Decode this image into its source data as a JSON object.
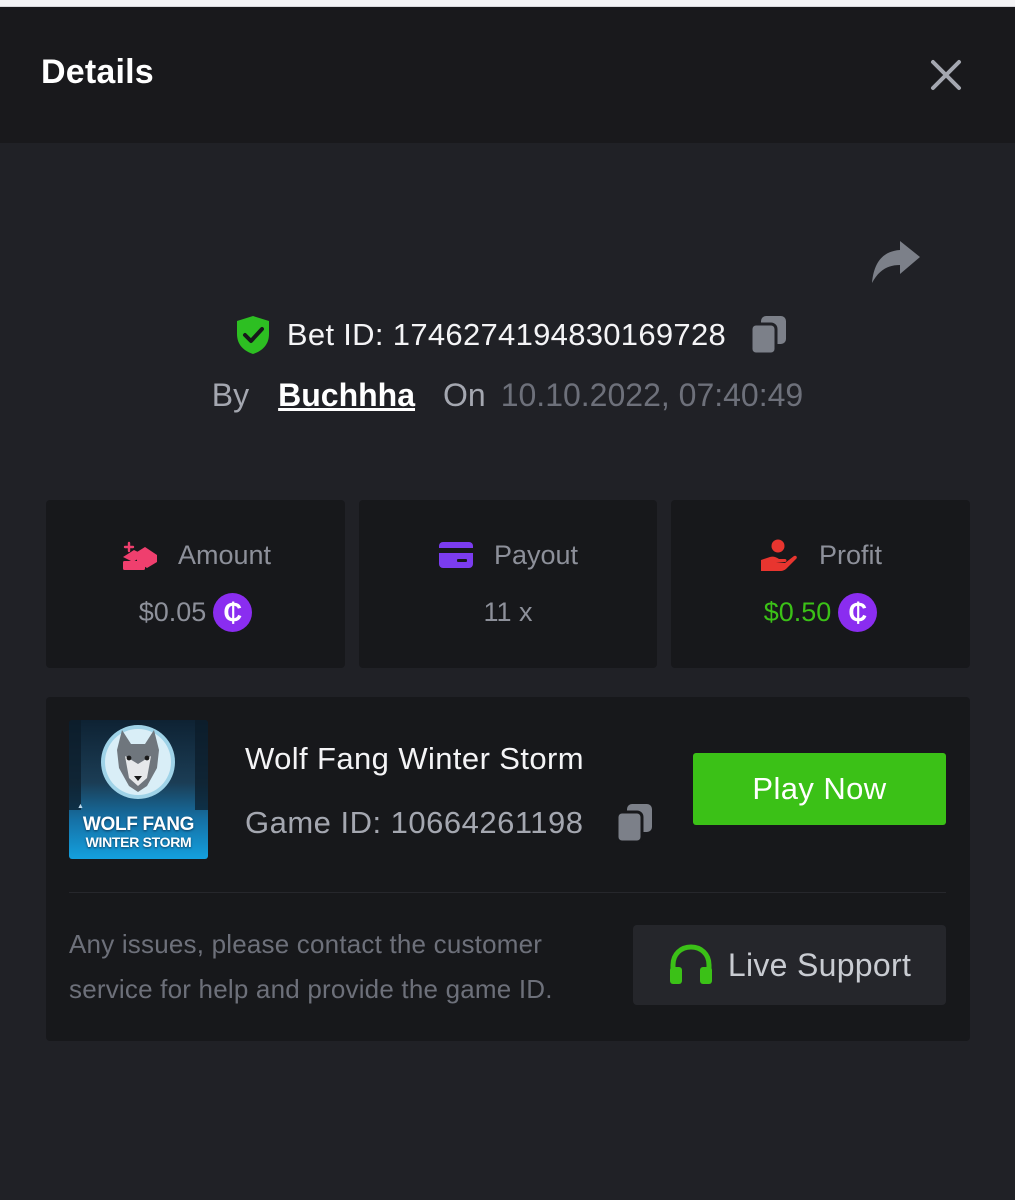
{
  "header": {
    "title": "Details"
  },
  "bet": {
    "id_label": "Bet ID:",
    "id": "1746274194830169728",
    "by_label": "By",
    "username": "Buchhha",
    "on_label": "On",
    "datetime": "10.10.2022, 07:40:49"
  },
  "stats": {
    "amount": {
      "label": "Amount",
      "value": "$0.05",
      "coin": "₵",
      "icon": "amount-icon"
    },
    "payout": {
      "label": "Payout",
      "value": "11 x",
      "icon": "card-icon"
    },
    "profit": {
      "label": "Profit",
      "value": "$0.50",
      "coin": "₵",
      "icon": "hand-coin-icon"
    }
  },
  "game": {
    "name": "Wolf Fang Winter Storm",
    "id_label": "Game ID:",
    "id": "10664261198",
    "play_label": "Play Now",
    "thumbnail": {
      "line1": "WOLF FANG",
      "line2": "WINTER STORM"
    }
  },
  "support": {
    "help_text": "Any issues, please contact the customer service for help and provide the game ID.",
    "button_label": "Live Support"
  },
  "colors": {
    "modal_bg": "#202126",
    "header_bg": "#19191c",
    "card_bg": "#17181b",
    "accent_green": "#3bc117",
    "profit_green": "#3bc117",
    "coin_purple": "#8a2df0",
    "amount_pink": "#ef3f6e",
    "payout_purple": "#7b3cf0",
    "profit_red": "#e8352f"
  }
}
